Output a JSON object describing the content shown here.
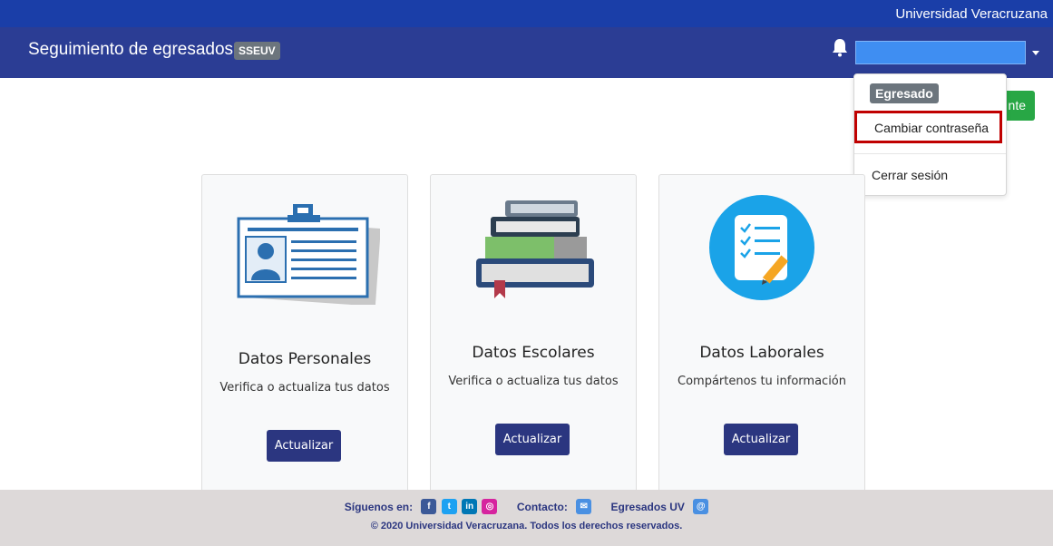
{
  "topbar": {
    "university": "Universidad Veracruzana"
  },
  "header": {
    "title": "Seguimiento de egresados",
    "badge": "SSEUV",
    "user_name": ""
  },
  "green_button": {
    "label": "nte"
  },
  "user_menu": {
    "role": "Egresado",
    "items": [
      "Cambiar contraseña",
      "Cerrar sesión"
    ]
  },
  "cards": [
    {
      "title": "Datos Personales",
      "text": "Verifica o actualiza tus datos",
      "button": "Actualizar"
    },
    {
      "title": "Datos Escolares",
      "text": "Verifica o actualiza tus datos",
      "button": "Actualizar"
    },
    {
      "title": "Datos Laborales",
      "text": "Compártenos tu información",
      "button": "Actualizar"
    }
  ],
  "footer": {
    "follow_label": "Síguenos en:",
    "contact_label": "Contacto:",
    "egresados_label": "Egresados UV",
    "social_icons": [
      "facebook-icon",
      "twitter-icon",
      "linkedin-icon",
      "instagram-icon"
    ],
    "copyright": "© 2020 Universidad Veracruzana. Todos los derechos reservados."
  },
  "colors": {
    "top_strip": "#1a3ea8",
    "header": "#2b3d94",
    "button": "#2b3680",
    "green": "#28a745",
    "highlight": "#c00000",
    "footer": "#ddd9d9"
  }
}
